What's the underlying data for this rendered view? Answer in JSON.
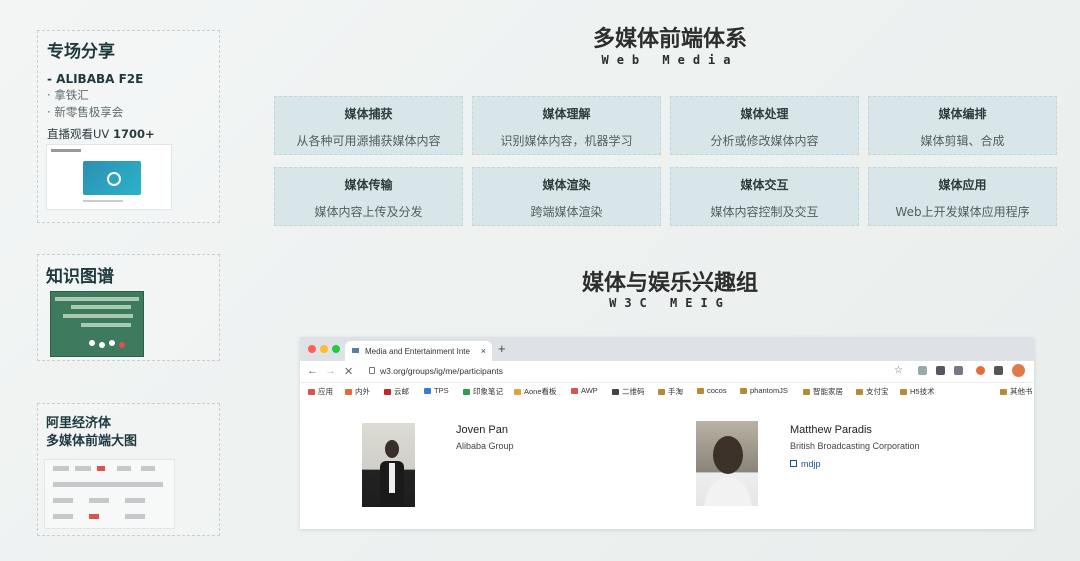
{
  "left": {
    "special": {
      "title": "专场分享",
      "brand": "- ALIBABA F2E",
      "items": [
        "拿铁汇",
        "新零售极享会"
      ],
      "views_label": "直播观看UV",
      "views_value": "1700+"
    },
    "knowledge": {
      "title": "知识图谱"
    },
    "map": {
      "title_line1": "阿里经济体",
      "title_line2": "多媒体前端大图"
    }
  },
  "web_media": {
    "title": "多媒体前端体系",
    "subtitle": "Web Media",
    "cards": [
      {
        "title": "媒体捕获",
        "desc": "从各种可用源捕获媒体内容"
      },
      {
        "title": "媒体理解",
        "desc": "识别媒体内容，机器学习"
      },
      {
        "title": "媒体处理",
        "desc": "分析或修改媒体内容"
      },
      {
        "title": "媒体编排",
        "desc": "媒体剪辑、合成"
      },
      {
        "title": "媒体传输",
        "desc": "媒体内容上传及分发"
      },
      {
        "title": "媒体渲染",
        "desc": "跨端媒体渲染"
      },
      {
        "title": "媒体交互",
        "desc": "媒体内容控制及交互"
      },
      {
        "title": "媒体应用",
        "desc": "Web上开发媒体应用程序"
      }
    ]
  },
  "meig": {
    "title": "媒体与娱乐兴趣组",
    "subtitle": "W3C MEIG"
  },
  "browser": {
    "tab_title": "Media and Entertainment Inte",
    "tab_close": "×",
    "new_tab": "+",
    "url": "w3.org/groups/ig/me/participants",
    "bookmarks": [
      "应用",
      "内外",
      "云邮",
      "TPS",
      "印象笔记",
      "Aone看板",
      "AWP",
      "二维码",
      "手淘",
      "cocos",
      "phantomJS",
      "智能家居",
      "支付宝",
      "H5技术",
      "其他书"
    ],
    "people": [
      {
        "name": "Joven Pan",
        "org": "Alibaba Group",
        "link": ""
      },
      {
        "name": "Matthew Paradis",
        "org": "British Broadcasting Corporation",
        "link": "mdjp"
      }
    ]
  },
  "colors": {
    "card_bg": "#d8e6e9",
    "title_dark": "#1f3a3f",
    "chrome_red": "#ff5f57",
    "chrome_yellow": "#febc2e",
    "chrome_green": "#28c840"
  }
}
